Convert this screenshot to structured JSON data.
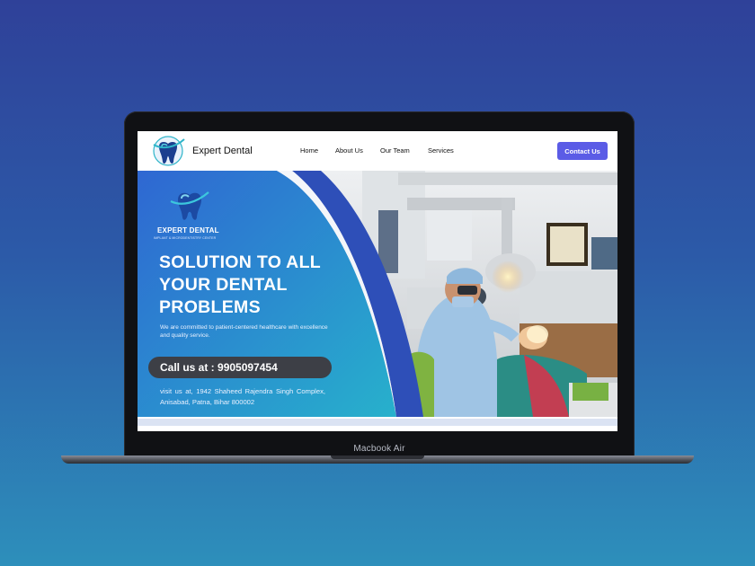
{
  "device": {
    "label": "Macbook Air"
  },
  "colors": {
    "background_top": "#2f4199",
    "background_bottom": "#2d8fbb",
    "accent": "#5b5ce6",
    "hero_blue": "#2a6fd6",
    "arc_blue": "#2e4fb8"
  },
  "header": {
    "brand": "Expert Dental",
    "logo_icon": "tooth-logo-icon",
    "nav": [
      {
        "label": "Home"
      },
      {
        "label": "About Us"
      },
      {
        "label": "Our Team"
      },
      {
        "label": "Services"
      }
    ],
    "contact_button": "Contact Us"
  },
  "hero": {
    "logo_icon": "tooth-logo-icon",
    "brand": "EXPERT DENTAL",
    "brand_sub": "IMPLANT & MICRODENTISTRY CENTER",
    "headline": [
      "SOLUTION TO ALL",
      "YOUR DENTAL",
      "PROBLEMS"
    ],
    "tagline": "We are committed to patient-centered healthcare with excellence and quality service.",
    "call": "Call us at : 9905097454",
    "address": "visit us at, 1942 Shaheed Rajendra Singh Complex, Anisabad, Patna, Bihar 800002",
    "photo": "dentist-treating-patient-photo"
  }
}
